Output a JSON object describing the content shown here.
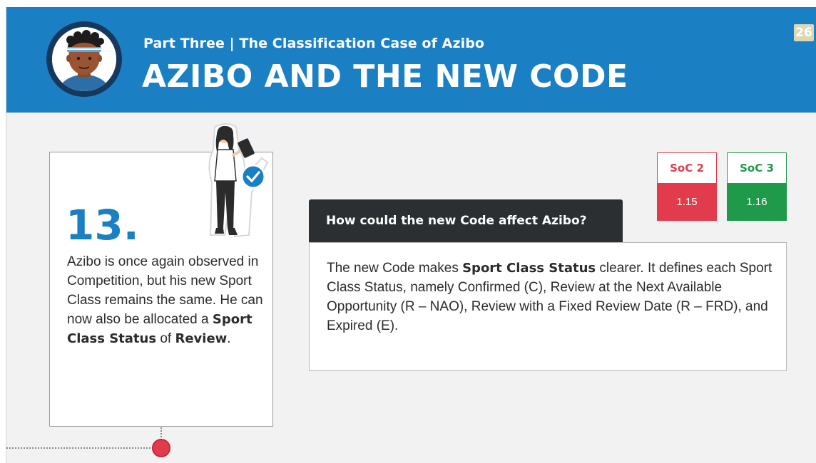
{
  "header": {
    "subtitle": "Part Three | The Classification Case of Azibo",
    "title": "AZIBO AND THE NEW CODE",
    "page_number": "26",
    "avatar_icon": "athlete-avatar-icon"
  },
  "card": {
    "number": "13.",
    "text_1": "Azibo is once again observed in Competition, but his new Sport Class remains the same. He can now also be allocated a ",
    "bold_1": "Sport Class Status",
    "text_2": " of ",
    "bold_2": "Review",
    "text_3": ".",
    "figure_icon": "woman-with-checklist-icon"
  },
  "soc": [
    {
      "label": "SoC 2",
      "value": "1.15",
      "color": "#e23b4c"
    },
    {
      "label": "SoC 3",
      "value": "1.16",
      "color": "#1e9a4a"
    }
  ],
  "question": {
    "title": "How could the new Code affect Azibo?",
    "text_1": "The new Code makes ",
    "bold_1": "Sport Class Status",
    "text_2": " clearer. It defines each Sport Class Status, namely Confirmed (C), Review at the Next Available Opportunity (R – NAO), Review with a Fixed Review Date (R – FRD), and Expired (E)."
  },
  "colors": {
    "header_blue": "#1b7fc4",
    "accent_red": "#e23b4c",
    "accent_green": "#1e9a4a",
    "dark": "#2b2f31"
  }
}
